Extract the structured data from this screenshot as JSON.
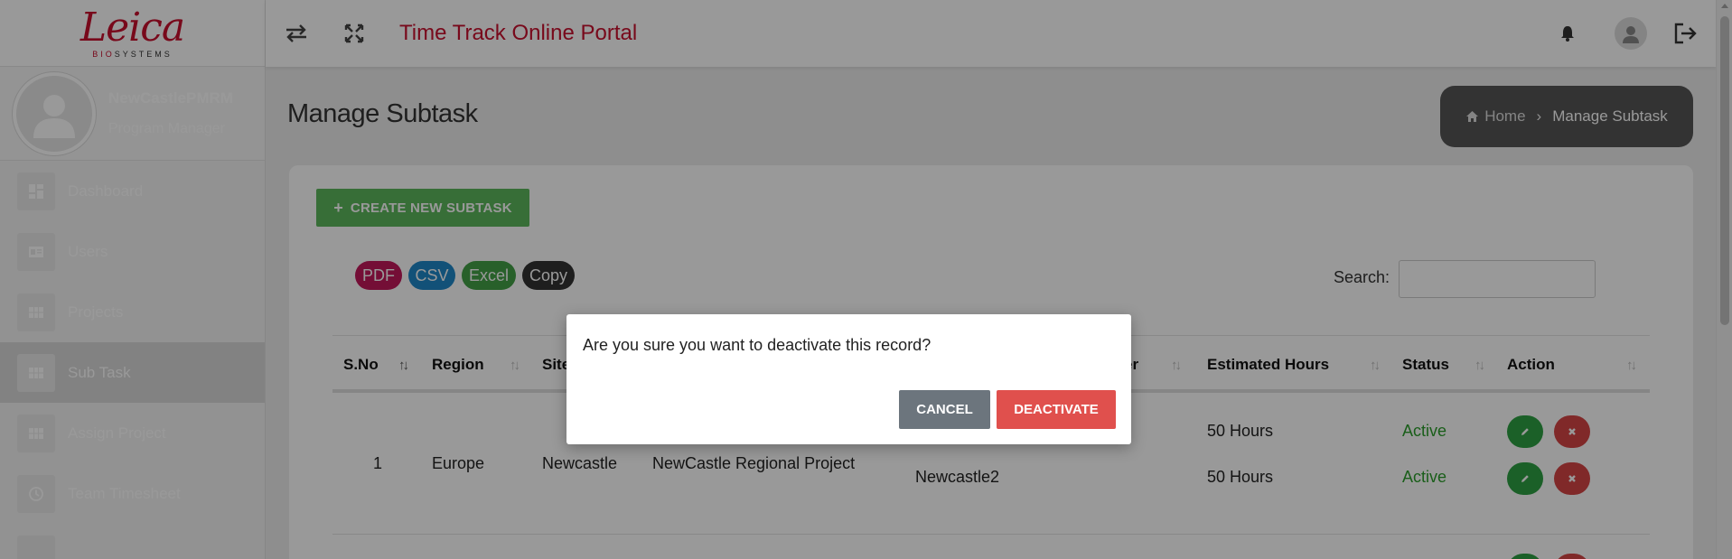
{
  "brand": {
    "logo_text": "Leica",
    "logo_sub_1": "BIO",
    "logo_sub_2": "SYSTEMS"
  },
  "profile": {
    "name": "NewCastlePMRM",
    "role": "Program Manager"
  },
  "sidebar": {
    "items": [
      {
        "label": "Dashboard",
        "icon": "dashboard-icon"
      },
      {
        "label": "Users",
        "icon": "id-card-icon"
      },
      {
        "label": "Projects",
        "icon": "grid-icon"
      },
      {
        "label": "Sub Task",
        "icon": "grid-icon",
        "active": true
      },
      {
        "label": "Assign Project",
        "icon": "grid-icon"
      },
      {
        "label": "Team Timesheet",
        "icon": "clock-icon"
      }
    ]
  },
  "header": {
    "title": "Time Track Online Portal"
  },
  "page": {
    "title": "Manage Subtask",
    "breadcrumb": {
      "home": "Home",
      "current": "Manage Subtask"
    }
  },
  "toolbar": {
    "create_label": "CREATE NEW SUBTASK",
    "export": [
      {
        "label": "PDF",
        "color": "#c2185b"
      },
      {
        "label": "CSV",
        "color": "#1e88c8"
      },
      {
        "label": "Excel",
        "color": "#43a047"
      },
      {
        "label": "Copy",
        "color": "#333333"
      }
    ],
    "search_label": "Search:",
    "search_value": ""
  },
  "table": {
    "columns": [
      "S.No",
      "Region",
      "Site",
      "",
      "",
      "Estimated Hours",
      "Status",
      "Action"
    ],
    "partial_header_suffix": "er",
    "row": {
      "sno": "1",
      "region": "Europe",
      "site": "Newcastle",
      "project": "NewCastle Regional Project",
      "subtask_2": "Newcastle2",
      "hours": [
        "50 Hours",
        "50 Hours"
      ],
      "status": [
        "Active",
        "Active"
      ]
    }
  },
  "modal": {
    "message": "Are you sure you want to deactivate this record?",
    "cancel_label": "CANCEL",
    "confirm_label": "DEACTIVATE"
  },
  "colors": {
    "brand_red": "#c8102e",
    "success": "#5cb85c",
    "danger": "#e0504d"
  }
}
